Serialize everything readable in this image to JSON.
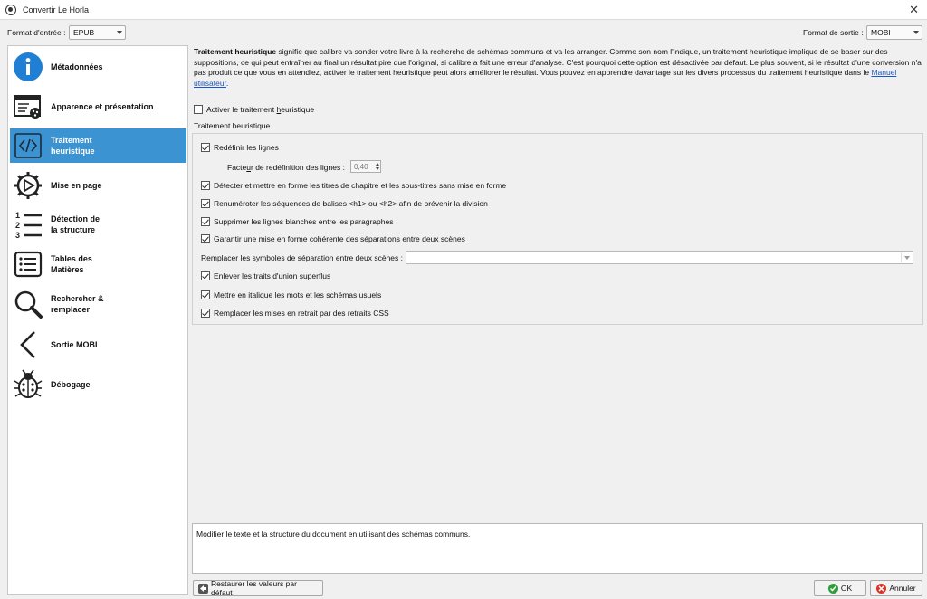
{
  "window": {
    "title": "Convertir Le Horla"
  },
  "format_bar": {
    "input_label": "Format d'entrée :",
    "input_value": "EPUB",
    "output_label": "Format de sortie :",
    "output_value": "MOBI"
  },
  "sidebar": {
    "selected_index": 2,
    "items": [
      {
        "label": "Métadonnées",
        "icon": "info-icon"
      },
      {
        "label": "Apparence et présentation",
        "icon": "appearance-icon"
      },
      {
        "label": "Traitement\nheuristique",
        "icon": "code-icon"
      },
      {
        "label": "Mise en page",
        "icon": "page-setup-gear-icon"
      },
      {
        "label": "Détection de\nla structure",
        "icon": "numbered-list-icon"
      },
      {
        "label": "Tables des\nMatières",
        "icon": "toc-list-icon"
      },
      {
        "label": "Rechercher &\nremplacer",
        "icon": "search-icon"
      },
      {
        "label": "Sortie MOBI",
        "icon": "chevron-left-icon"
      },
      {
        "label": "Débogage",
        "icon": "bug-icon"
      }
    ]
  },
  "description": {
    "bold": "Traitement heuristique",
    "text": " signifie que calibre va sonder votre livre à la recherche de schémas communs et va les arranger. Comme son nom l'indique, un traitement heuristique implique de se baser sur des suppositions, ce qui peut entraîner au final un résultat pire que l'original, si calibre a fait une erreur d'analyse. C'est pourquoi cette option est désactivée par défaut. Le plus souvent, si le résultat d'une conversion n'a pas produit ce que vous en attendiez, activer le traitement heuristique peut alors améliorer le résultat. Vous pouvez en apprendre davantage sur les divers processus du traitement heuristique dans le ",
    "link": "Manuel utilisateur",
    "end": "."
  },
  "enable_heuristics": {
    "pre": "Activer le traitement ",
    "underlined": "h",
    "post": "euristique",
    "checked": false
  },
  "group": {
    "title": "Traitement heuristique",
    "redefine_lines": {
      "label": "Redéfinir les lignes",
      "checked": true
    },
    "factor": {
      "pre": "Facte",
      "underlined": "u",
      "post": "r de redéfinition des lignes :",
      "value": "0,40"
    },
    "options": [
      {
        "label": "Détecter et mettre en forme les titres de chapitre et les sous-titres sans mise en forme",
        "checked": true
      },
      {
        "label": "Renuméroter les séquences de balises <h1> ou <h2> afin de prévenir la division",
        "checked": true
      },
      {
        "label": "Supprimer les lignes blanches entre les paragraphes",
        "checked": true
      },
      {
        "label": "Garantir une mise en forme cohérente des séparations entre deux scènes",
        "checked": true
      }
    ],
    "replace_scene": {
      "label": "Remplacer les symboles de séparation entre deux scènes :",
      "value": ""
    },
    "options2": [
      {
        "label": "Enlever les traits d'union superflus",
        "checked": true
      },
      {
        "label": "Mettre en italique les mots et les schémas usuels",
        "checked": true
      },
      {
        "label": "Remplacer les mises en retrait par des retraits CSS",
        "checked": true
      }
    ]
  },
  "help_text": "Modifier le texte et la structure du document en utilisant des schémas communs.",
  "buttons": {
    "restore": "Restaurer les valeurs par défaut",
    "ok": "OK",
    "cancel": "Annuler"
  },
  "colors": {
    "selection": "#3b93d2",
    "ok_icon": "#2e9e3a",
    "cancel_icon": "#d9342b",
    "link": "#1a56c7"
  }
}
